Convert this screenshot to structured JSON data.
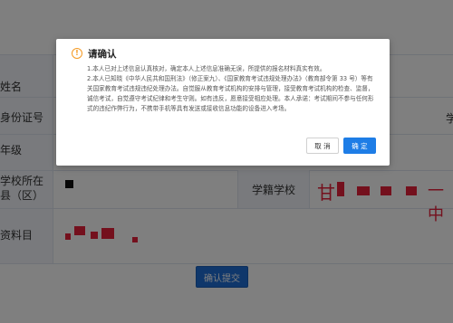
{
  "form": {
    "rows": [
      {
        "label": "姓名"
      },
      {
        "label": "身份证号"
      },
      {
        "label": "年级"
      },
      {
        "label": "学校所在县（区）"
      },
      {
        "label": "资料目"
      }
    ],
    "right_edge_label": "学",
    "school_label": "学籍学校",
    "school_value": "甘",
    "school_value_tail": "一中",
    "submit_label": "确认提交"
  },
  "dialog": {
    "icon": "warning-circle-icon",
    "title": "请确认",
    "paragraphs": [
      "1.本人已对上述信息认真核对，确定本人上述信息准确无误，所提供的报名材料真实有效。",
      "2.本人已知晓《中华人民共和国刑法》（修正案九）、《国家教育考试违规处理办法》（教育部令第 33 号）等有关国家教育考试违规违纪处理办法。自觉服从教育考试机构的安排与管理，接受教育考试机构的检查、监督，诚信考试，自觉遵守考试纪律和考生守则。如有违反，愿意接受相应处理。本人承诺：考试期间不参与任何形式的违纪作弊行为，不携带手机等具有发送或接收信息功能的设备进入考场。"
    ],
    "cancel_label": "取 消",
    "ok_label": "确 定"
  },
  "colors": {
    "primary": "#1e7de6",
    "warning": "#f59a23",
    "redaction": "#e8203a"
  }
}
